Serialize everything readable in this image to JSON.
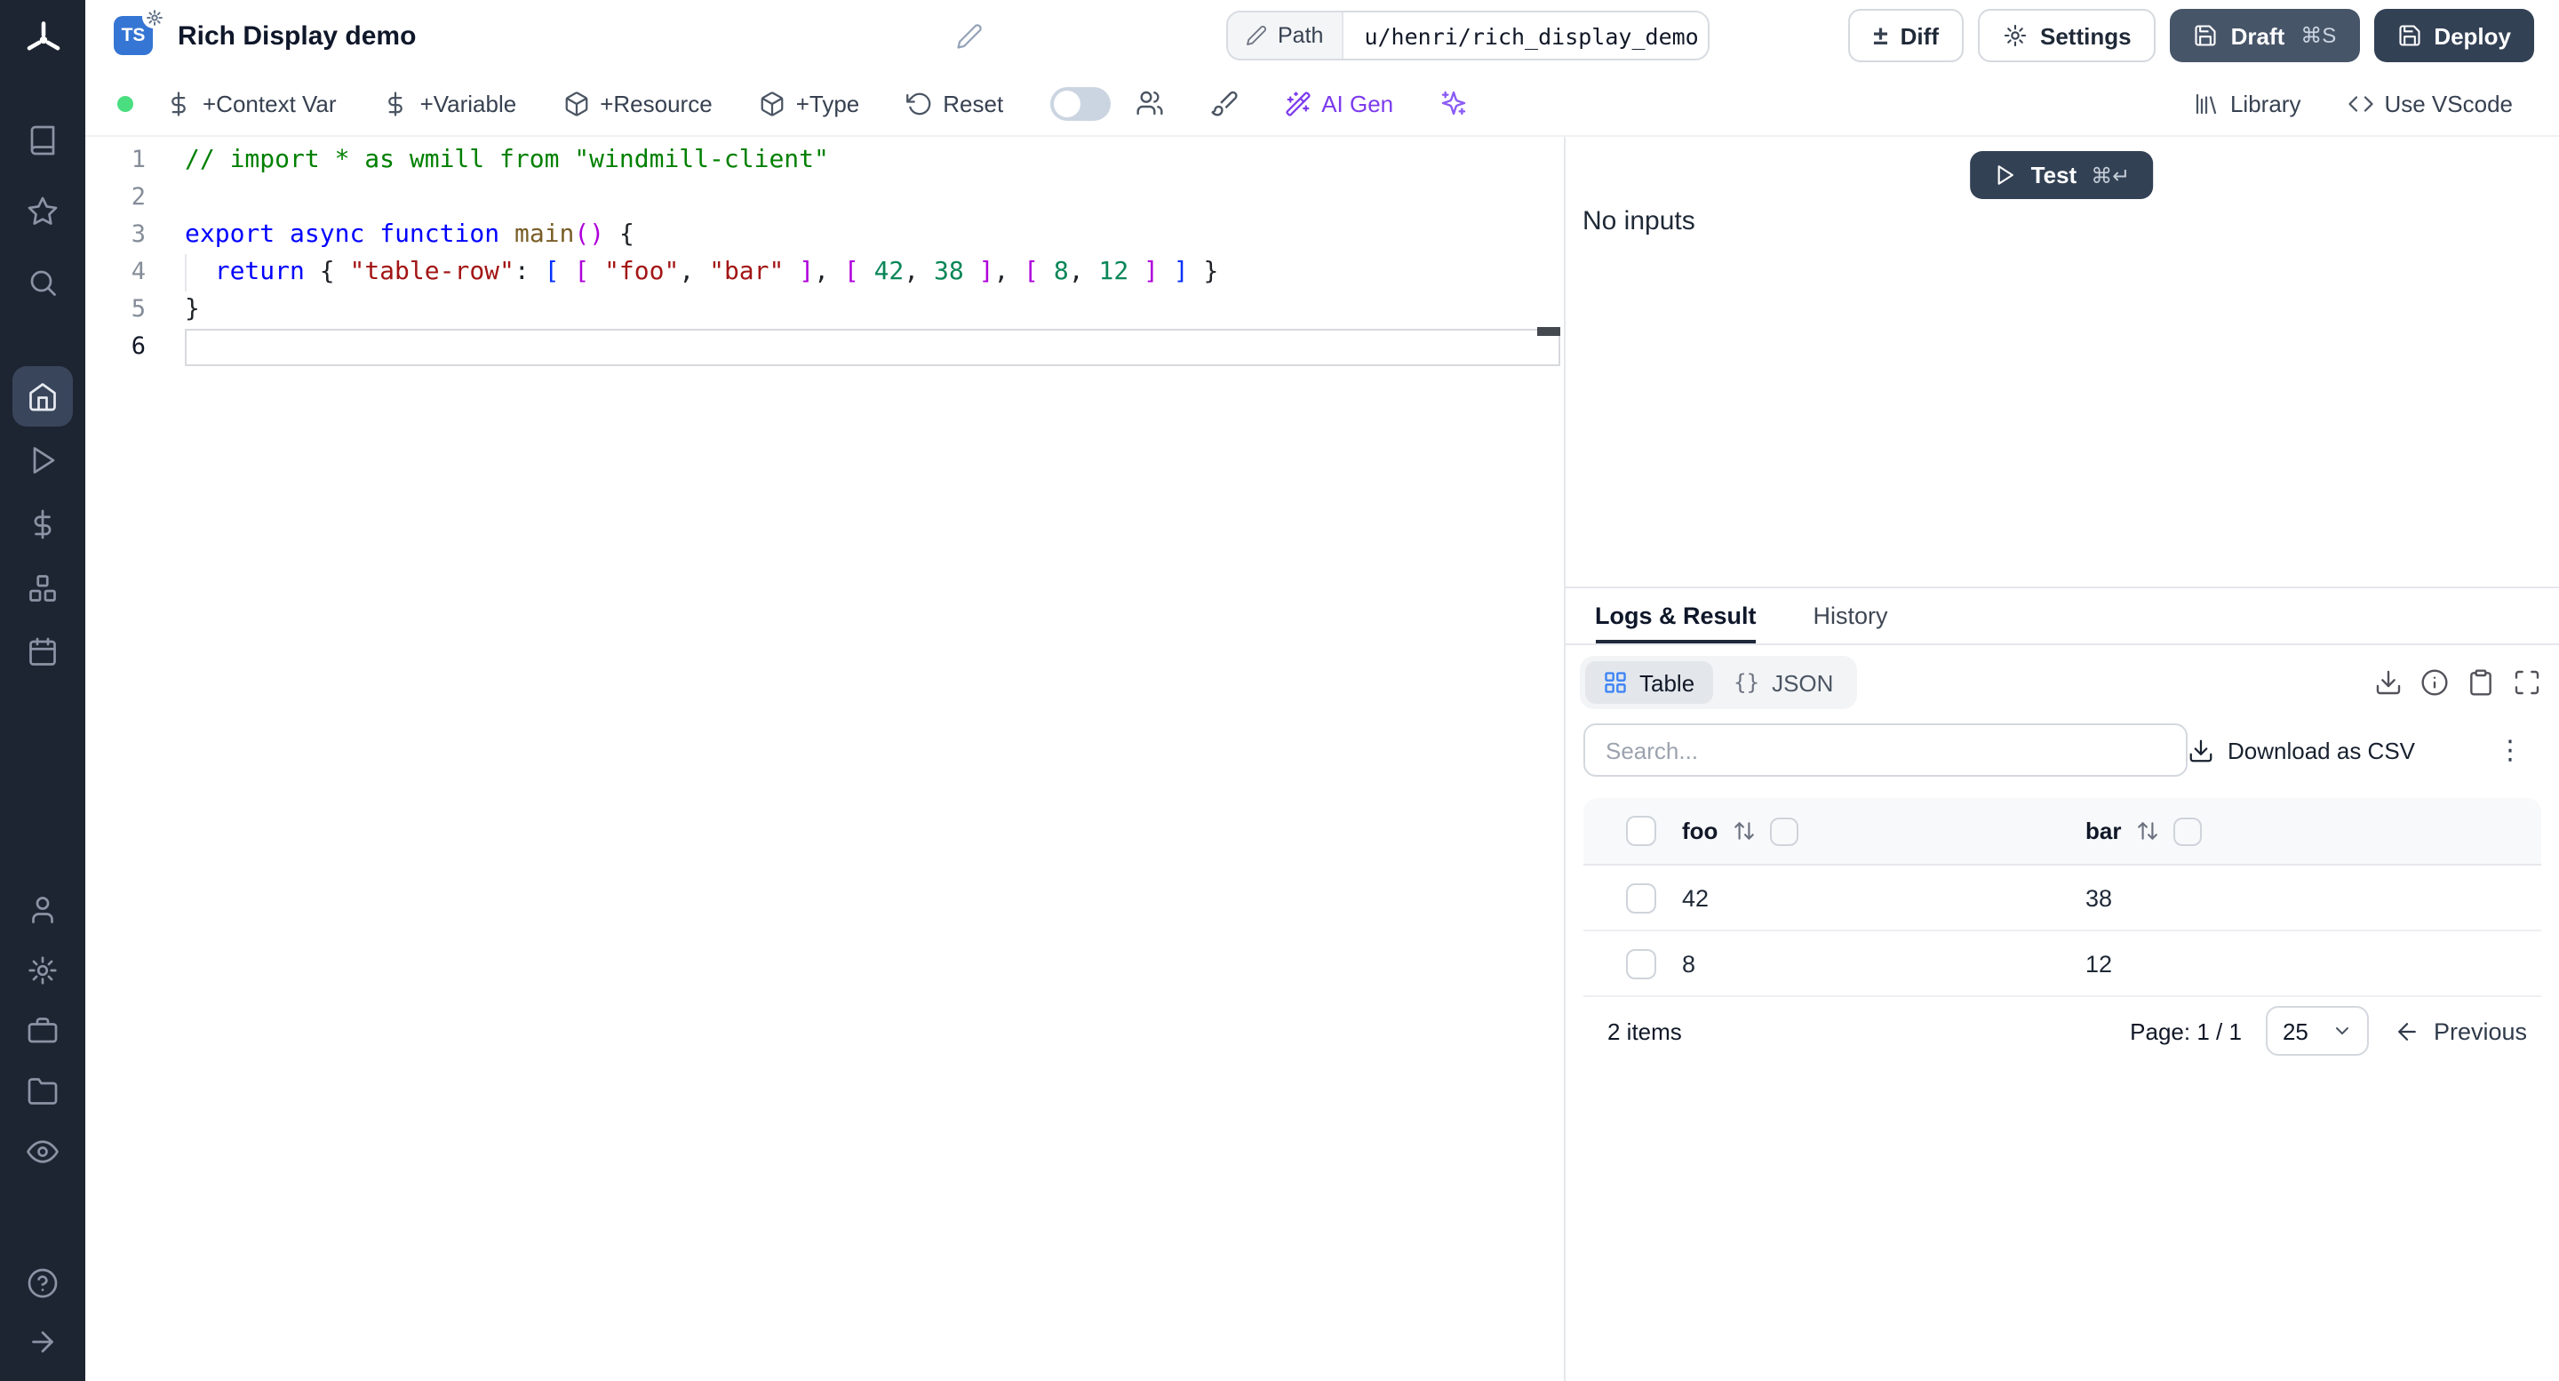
{
  "sidebar": {
    "icons": [
      "windmill-logo",
      "book",
      "star",
      "search",
      "home",
      "play",
      "dollar",
      "boxes",
      "calendar",
      "user",
      "gear",
      "briefcase",
      "folder",
      "eye",
      "help-circle",
      "arrow-right"
    ],
    "active_item": "home"
  },
  "header": {
    "language_badge": "TS",
    "title": "Rich Display demo",
    "path_label": "Path",
    "path_value": "u/henri/rich_display_demo",
    "buttons": {
      "diff": "Diff",
      "settings": "Settings",
      "draft": "Draft",
      "draft_shortcut": "⌘S",
      "deploy": "Deploy"
    }
  },
  "toolbar": {
    "add_context_var": "+Context Var",
    "add_variable": "+Variable",
    "add_resource": "+Resource",
    "add_type": "+Type",
    "reset": "Reset",
    "ai_gen": "AI Gen",
    "library": "Library",
    "use_vscode": "Use VScode",
    "saved_indicator_color": "#4ade80",
    "ai_color": "#7c3aed"
  },
  "editor": {
    "lines": [
      {
        "num": "1",
        "tokens": [
          {
            "c": "comment",
            "t": "// import * as wmill from \"windmill-client\""
          }
        ]
      },
      {
        "num": "2",
        "tokens": []
      },
      {
        "num": "3",
        "tokens": [
          {
            "c": "keyword",
            "t": "export"
          },
          {
            "c": "plain",
            "t": " "
          },
          {
            "c": "keyword",
            "t": "async"
          },
          {
            "c": "plain",
            "t": " "
          },
          {
            "c": "keyword",
            "t": "function"
          },
          {
            "c": "plain",
            "t": " "
          },
          {
            "c": "function",
            "t": "main"
          },
          {
            "c": "bracket2",
            "t": "()"
          },
          {
            "c": "plain",
            "t": " {"
          }
        ]
      },
      {
        "num": "4",
        "tokens": [
          {
            "c": "plain",
            "t": "  "
          },
          {
            "c": "keyword",
            "t": "return"
          },
          {
            "c": "plain",
            "t": " { "
          },
          {
            "c": "string",
            "t": "\"table-row\""
          },
          {
            "c": "plain",
            "t": ": "
          },
          {
            "c": "bracket1",
            "t": "[ "
          },
          {
            "c": "bracket2",
            "t": "[ "
          },
          {
            "c": "string",
            "t": "\"foo\""
          },
          {
            "c": "plain",
            "t": ", "
          },
          {
            "c": "string",
            "t": "\"bar\""
          },
          {
            "c": "bracket2",
            "t": " ]"
          },
          {
            "c": "plain",
            "t": ", "
          },
          {
            "c": "bracket2",
            "t": "[ "
          },
          {
            "c": "number",
            "t": "42"
          },
          {
            "c": "plain",
            "t": ", "
          },
          {
            "c": "number",
            "t": "38"
          },
          {
            "c": "bracket2",
            "t": " ]"
          },
          {
            "c": "plain",
            "t": ", "
          },
          {
            "c": "bracket2",
            "t": "[ "
          },
          {
            "c": "number",
            "t": "8"
          },
          {
            "c": "plain",
            "t": ", "
          },
          {
            "c": "number",
            "t": "12"
          },
          {
            "c": "bracket2",
            "t": " ]"
          },
          {
            "c": "bracket1",
            "t": " ]"
          },
          {
            "c": "plain",
            "t": " }"
          }
        ]
      },
      {
        "num": "5",
        "tokens": [
          {
            "c": "plain",
            "t": "}"
          }
        ]
      },
      {
        "num": "6",
        "tokens": [],
        "cursor": true
      }
    ]
  },
  "run_panel": {
    "test": "Test",
    "test_shortcut": "⌘↵",
    "no_inputs": "No inputs"
  },
  "result_panel": {
    "tabs": [
      {
        "label": "Logs & Result",
        "active": true
      },
      {
        "label": "History",
        "active": false
      }
    ],
    "view_toggle": {
      "table": "Table",
      "json": "JSON"
    },
    "icons": [
      "download",
      "info",
      "clipboard",
      "maximize",
      "kebab-menu"
    ],
    "search_placeholder": "Search...",
    "download_csv": "Download as CSV",
    "table": {
      "columns": [
        "foo",
        "bar"
      ],
      "rows": [
        [
          "42",
          "38"
        ],
        [
          "8",
          "12"
        ]
      ],
      "items_count": "2 items",
      "page": "Page: 1 / 1",
      "page_size": "25",
      "previous": "Previous"
    }
  },
  "colors": {
    "sidebar_bg": "#1e2532",
    "dark_button": "#334155",
    "ts_badge_blue": "#3575d3",
    "table_icon_blue": "#3b82f6"
  }
}
